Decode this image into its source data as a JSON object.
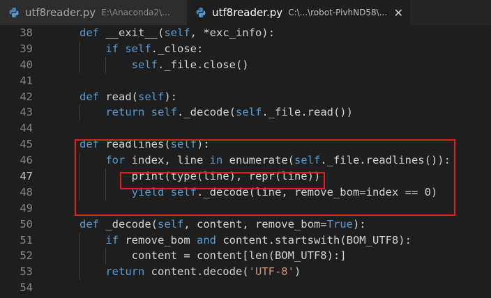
{
  "tabs": [
    {
      "title": "utf8reader.py",
      "path": "E:\\Anaconda2\\...",
      "active": false
    },
    {
      "title": "utf8reader.py",
      "path": "C:\\...\\robot-PivhND58\\...",
      "active": true,
      "close": "✕"
    }
  ],
  "colors": {
    "keyword": "#569cd6",
    "string": "#ce9178",
    "text": "#d4d4d4",
    "highlight_box": "#e02020"
  },
  "lines": [
    {
      "n": "38",
      "code": "def __exit__(self, *exc_info):"
    },
    {
      "n": "39",
      "code": "    if self._close:"
    },
    {
      "n": "40",
      "code": "        self._file.close()"
    },
    {
      "n": "41",
      "code": ""
    },
    {
      "n": "42",
      "code": "def read(self):"
    },
    {
      "n": "43",
      "code": "    return self._decode(self._file.read())"
    },
    {
      "n": "44",
      "code": ""
    },
    {
      "n": "45",
      "code": "def readlines(self):"
    },
    {
      "n": "46",
      "code": "    for index, line in enumerate(self._file.readlines()):"
    },
    {
      "n": "47",
      "code": "        print(type(line), repr(line))"
    },
    {
      "n": "48",
      "code": "        yield self._decode(line, remove_bom=index == 0)"
    },
    {
      "n": "49",
      "code": ""
    },
    {
      "n": "50",
      "code": "def _decode(self, content, remove_bom=True):"
    },
    {
      "n": "51",
      "code": "    if remove_bom and content.startswith(BOM_UTF8):"
    },
    {
      "n": "52",
      "code": "        content = content[len(BOM_UTF8):]"
    },
    {
      "n": "53",
      "code": "    return content.decode('UTF-8')"
    },
    {
      "n": "54",
      "code": ""
    }
  ],
  "current_line": "47"
}
